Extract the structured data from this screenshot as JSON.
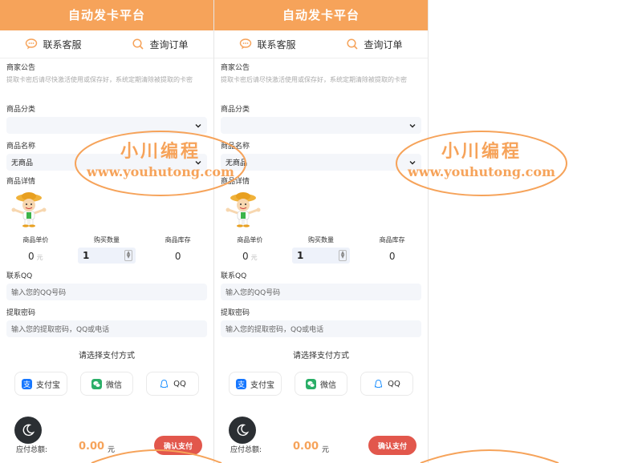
{
  "app": {
    "title": "自动发卡平台"
  },
  "toolbar": {
    "service_label": "联系客服",
    "query_label": "查询订单"
  },
  "form": {
    "notice_label": "商家公告",
    "notice_text": "提取卡密后请尽快激活使用或保存好，系统定期清除被提取的卡密",
    "category_label": "商品分类",
    "category_value": "",
    "name_label": "商品名称",
    "name_value": "无商品",
    "detail_label": "商品详情",
    "price_label": "商品单价",
    "price_value": "0",
    "price_unit": "元",
    "qty_label": "购买数量",
    "qty_value": "1",
    "stock_label": "商品库存",
    "stock_value": "0",
    "qq_label": "联系QQ",
    "qq_placeholder": "输入您的QQ号码",
    "pwd_label": "提取密码",
    "pwd_placeholder": "输入您的提取密码，QQ或电话"
  },
  "payment": {
    "title": "请选择支付方式",
    "options": [
      {
        "label": "支付宝",
        "icon": "alipay-icon",
        "color": "#1677ff"
      },
      {
        "label": "微信",
        "icon": "wechat-icon",
        "color": "#2aae67"
      },
      {
        "label": "QQ",
        "icon": "qq-icon",
        "color": "#1e90ff"
      }
    ]
  },
  "footer": {
    "amount_label": "应付总额:",
    "amount_value": "0.00",
    "amount_unit": "元",
    "confirm_label": "确认支付"
  },
  "watermark": {
    "line1": "小川编程",
    "line2": "www.youhutong.com"
  },
  "colors": {
    "header": "#f6a35a",
    "confirm": "#e2574c",
    "amount": "#f6a35a"
  }
}
